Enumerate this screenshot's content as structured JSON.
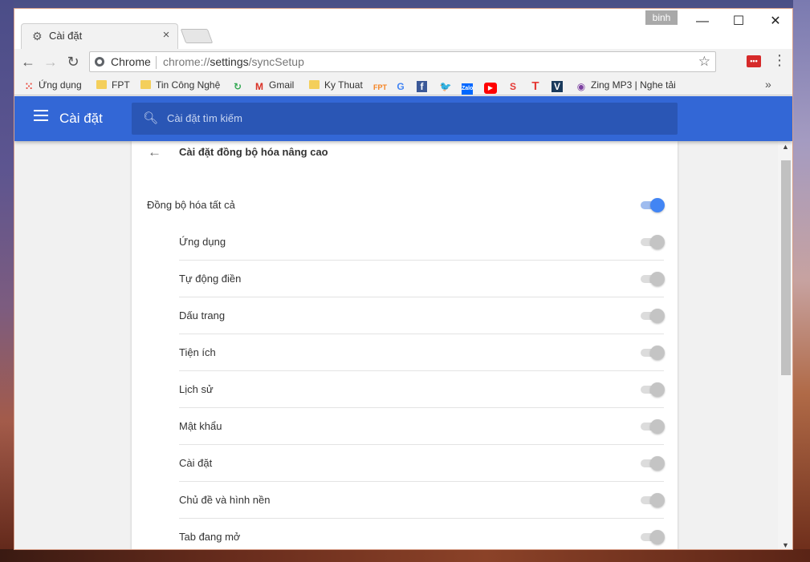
{
  "window": {
    "user_badge": "binh",
    "minimize": "—",
    "maximize": "☐",
    "close": "✕"
  },
  "tab": {
    "icon": "gear-icon",
    "title": "Cài đặt",
    "close": "×"
  },
  "toolbar": {
    "back": "←",
    "forward": "→",
    "reload": "↻",
    "site_label": "Chrome",
    "url_prefix": "chrome://",
    "url_host": "settings",
    "url_path": "/syncSetup",
    "star": "☆",
    "ext_label": "•••",
    "menu": "⋮"
  },
  "bookmarks": {
    "items": [
      {
        "label": "Ứng dụng",
        "icon": "apps-grid-icon"
      },
      {
        "label": "FPT",
        "icon": "folder-icon"
      },
      {
        "label": "Tin Công Nghệ",
        "icon": "folder-icon"
      },
      {
        "label": "",
        "icon": "refresh-colorful-icon"
      },
      {
        "label": "Gmail",
        "icon": "gmail-icon"
      },
      {
        "label": "Ky Thuat",
        "icon": "folder-icon"
      },
      {
        "label": "",
        "icon": "fpt-icon"
      },
      {
        "label": "",
        "icon": "google-translate-icon"
      },
      {
        "label": "",
        "icon": "facebook-icon"
      },
      {
        "label": "",
        "icon": "twitter-icon"
      },
      {
        "label": "",
        "icon": "zalo-icon"
      },
      {
        "label": "",
        "icon": "youtube-icon"
      },
      {
        "label": "",
        "icon": "soha-icon"
      },
      {
        "label": "",
        "icon": "t-icon"
      },
      {
        "label": "",
        "icon": "v-icon"
      },
      {
        "label": "Zing MP3 | Nghe tải",
        "icon": "zing-icon"
      }
    ],
    "more": "»"
  },
  "header": {
    "title": "Cài đặt",
    "search_placeholder": "Cài đặt tìm kiếm"
  },
  "sync": {
    "back": "←",
    "title": "Cài đặt đồng bộ hóa nâng cao",
    "sync_all": {
      "label": "Đồng bộ hóa tất cả",
      "on": true
    },
    "items": [
      {
        "label": "Ứng dụng",
        "on": false
      },
      {
        "label": "Tự động điền",
        "on": false
      },
      {
        "label": "Dấu trang",
        "on": false
      },
      {
        "label": "Tiện ích",
        "on": false
      },
      {
        "label": "Lịch sử",
        "on": false
      },
      {
        "label": "Mật khẩu",
        "on": false
      },
      {
        "label": "Cài đặt",
        "on": false
      },
      {
        "label": "Chủ đề và hình nền",
        "on": false
      },
      {
        "label": "Tab đang mở",
        "on": false
      }
    ]
  },
  "scrollbar": {
    "up": "▲",
    "down": "▼"
  },
  "colors": {
    "header_blue": "#3367d6",
    "toggle_on": "#4285f4"
  }
}
